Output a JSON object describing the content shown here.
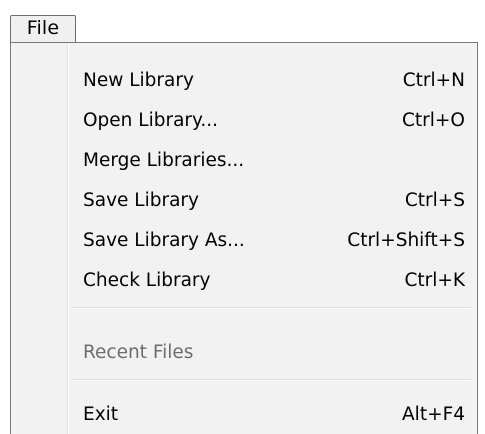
{
  "menubar": {
    "file_label": "File"
  },
  "menu": {
    "items": [
      {
        "label": "New Library",
        "shortcut": "Ctrl+N"
      },
      {
        "label": "Open Library...",
        "shortcut": "Ctrl+O"
      },
      {
        "label": "Merge Libraries...",
        "shortcut": ""
      },
      {
        "label": "Save Library",
        "shortcut": "Ctrl+S"
      },
      {
        "label": "Save Library As...",
        "shortcut": "Ctrl+Shift+S"
      },
      {
        "label": "Check Library",
        "shortcut": "Ctrl+K"
      }
    ],
    "recent_files_label": "Recent Files",
    "exit": {
      "label": "Exit",
      "shortcut": "Alt+F4"
    }
  },
  "colors": {
    "menu_background": "#f2f2f2",
    "disabled_text": "#6d6d6d",
    "border": "#7a7a7a"
  }
}
